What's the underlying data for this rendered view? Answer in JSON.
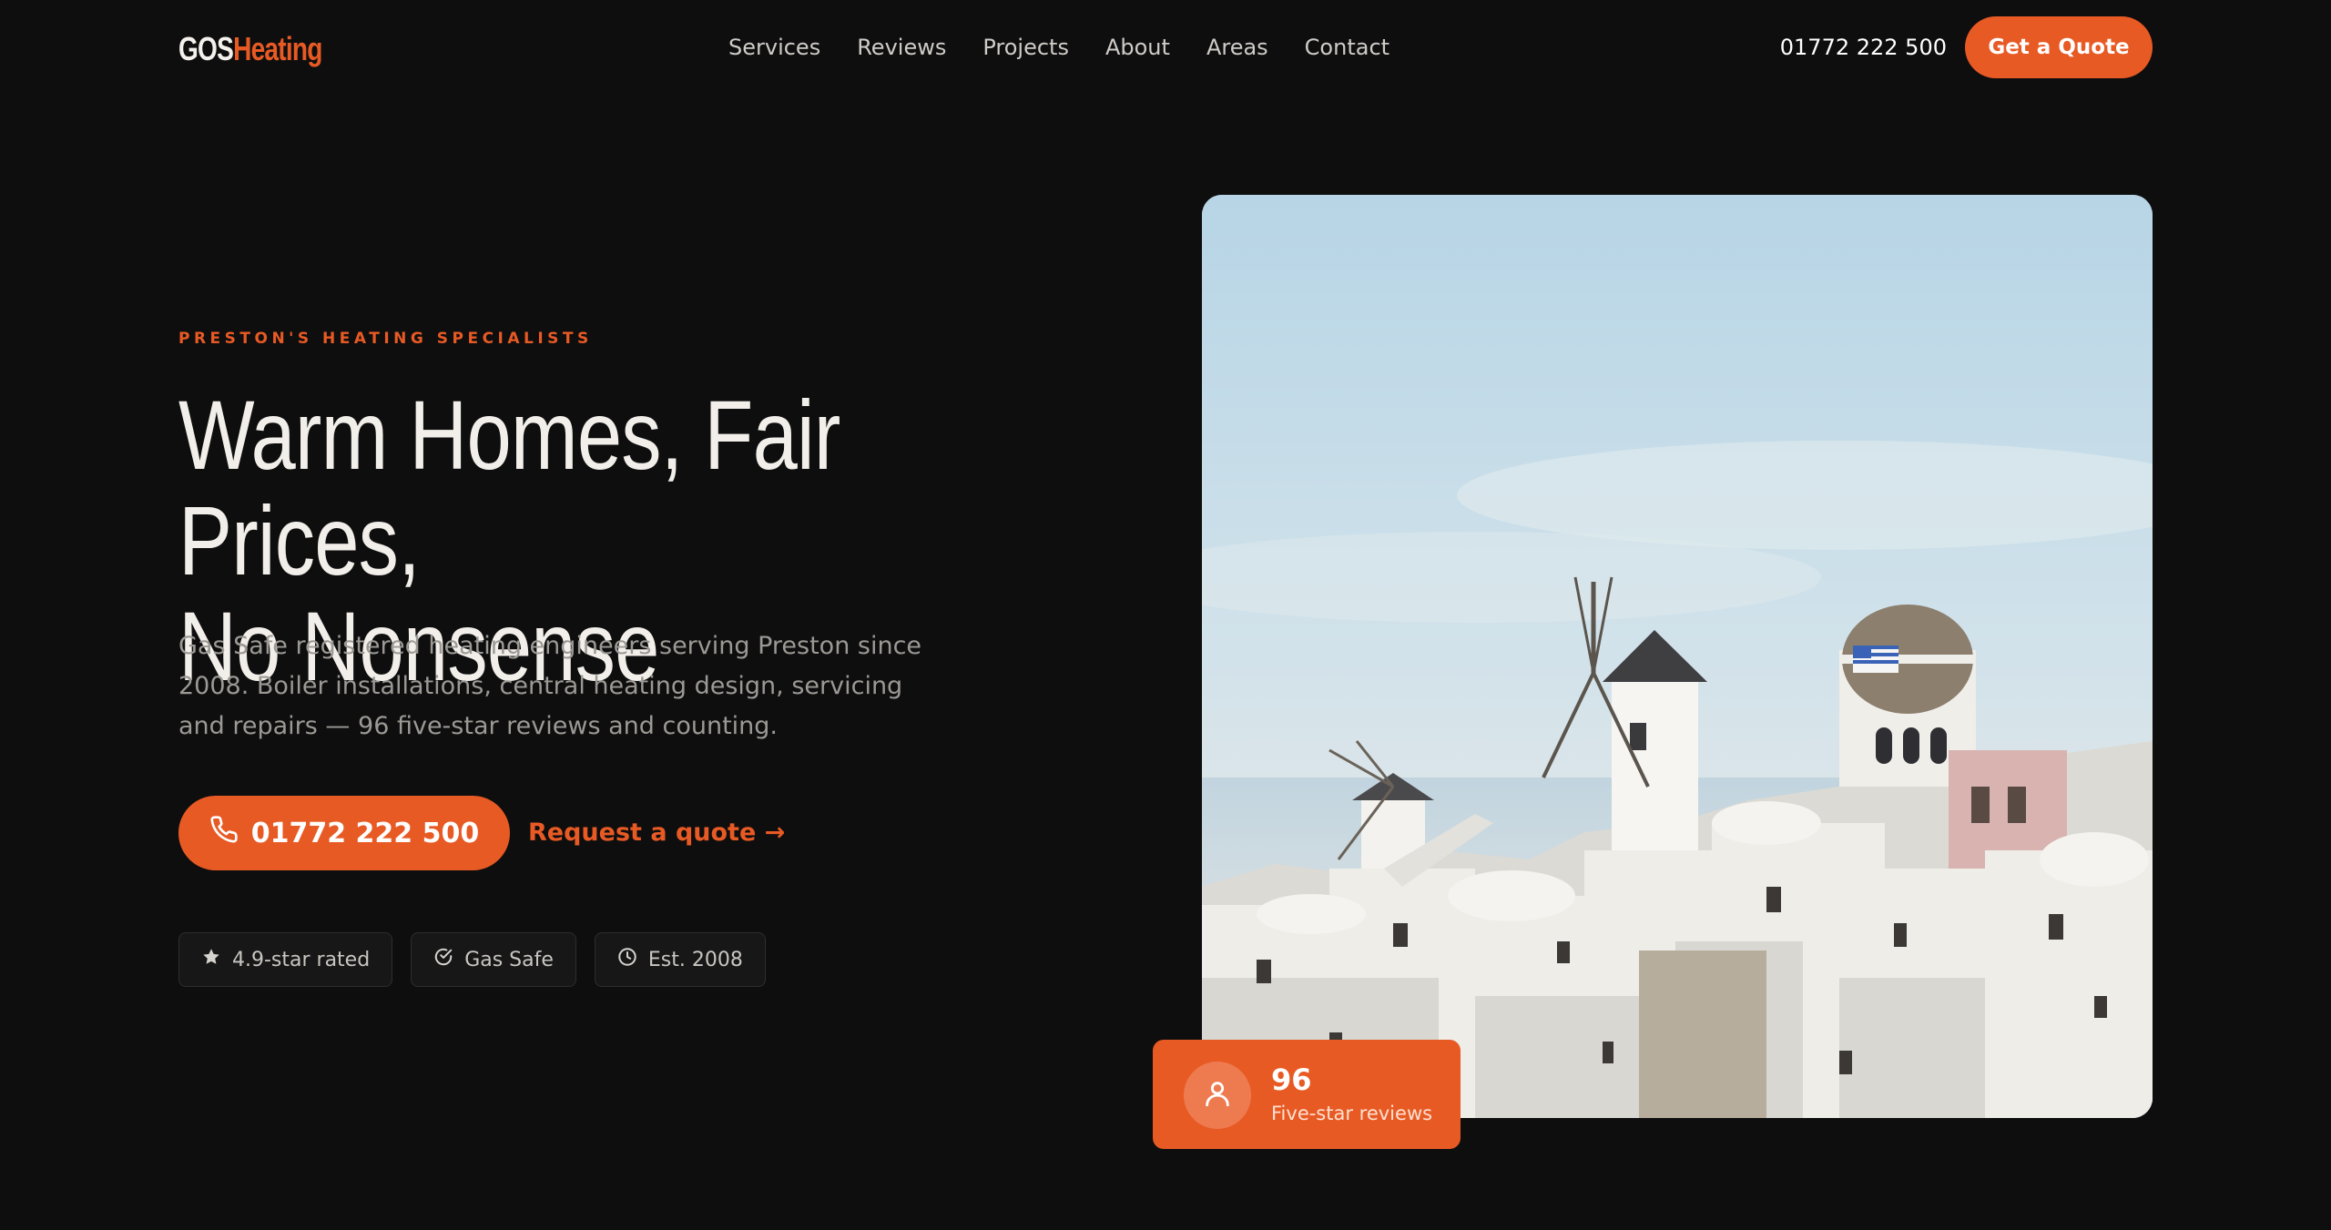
{
  "brand": {
    "name_part1": "GOS",
    "name_part2": "Heating",
    "accent_color": "#e85a24",
    "background_color": "#0e0e0f"
  },
  "nav": {
    "items": [
      {
        "label": "Services"
      },
      {
        "label": "Reviews"
      },
      {
        "label": "Projects"
      },
      {
        "label": "About"
      },
      {
        "label": "Areas"
      },
      {
        "label": "Contact"
      }
    ]
  },
  "header": {
    "phone": "01772 222 500",
    "cta_label": "Get a Quote"
  },
  "hero": {
    "eyebrow": "PRESTON'S HEATING SPECIALISTS",
    "headline_line1": "Warm Homes, Fair Prices,",
    "headline_line2": "No Nonsense",
    "subtext": "Gas Safe registered heating engineers serving Preston since 2008. Boiler installations, central heating design, servicing and repairs — 96 five-star reviews and counting.",
    "phone_button_label": "01772 222 500",
    "phone_icon": "phone-icon",
    "request_link_label": "Request a quote →",
    "badges": [
      {
        "icon": "star-icon",
        "label": "4.9-star rated"
      },
      {
        "icon": "check-circle-icon",
        "label": "Gas Safe"
      },
      {
        "icon": "clock-icon",
        "label": "Est. 2008"
      }
    ],
    "image_subject": "whitewashed hillside village with windmills under blue sky"
  },
  "review_card": {
    "icon": "user-icon",
    "count": "96",
    "label": "Five-star reviews"
  }
}
